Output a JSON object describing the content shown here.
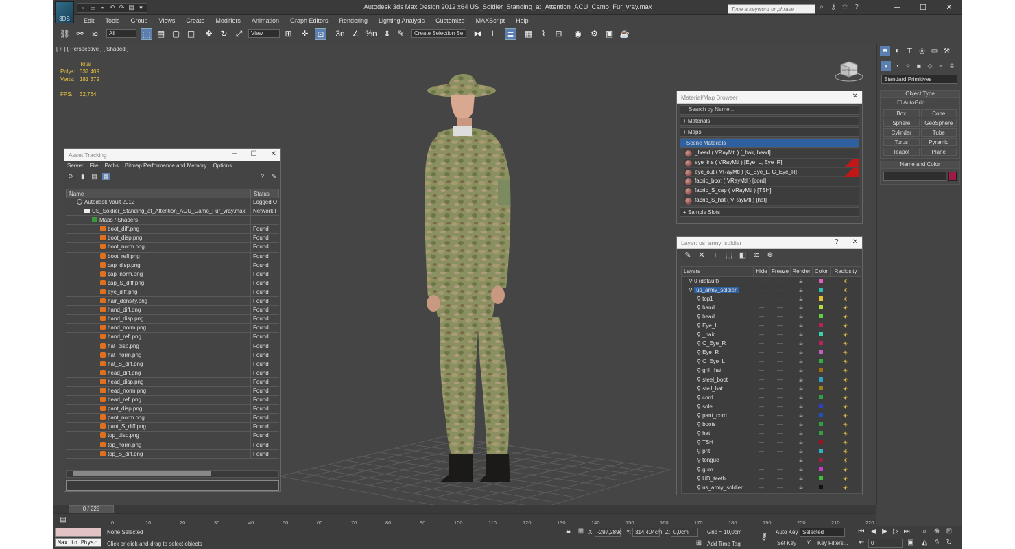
{
  "window": {
    "title": "Autodesk 3ds Max Design 2012 x64      US_Soldier_Standing_at_Attention_ACU_Camo_Fur_vray.max",
    "search_placeholder": "Type a keyword or phrase",
    "logo": "3DS"
  },
  "menu": [
    "Edit",
    "Tools",
    "Group",
    "Views",
    "Create",
    "Modifiers",
    "Animation",
    "Graph Editors",
    "Rendering",
    "Lighting Analysis",
    "Customize",
    "MAXScript",
    "Help"
  ],
  "toolbar": {
    "filter_value": "All",
    "ref_coord": "View",
    "selection_set_placeholder": "Create Selection Se",
    "snap_labels": [
      "3",
      "n",
      "%",
      "n"
    ]
  },
  "viewport": {
    "label": "[ + ] [ Perspective ] [ Shaded ]",
    "stats": {
      "header": "Total",
      "polys_label": "Polys:",
      "polys_value": "337 409",
      "verts_label": "Verts:",
      "verts_value": "181 379",
      "fps_label": "FPS:",
      "fps_value": "32,764"
    },
    "viewcube_label": "FRONT RIGHT"
  },
  "command_panel": {
    "dropdown": "Standard Primitives",
    "object_type_title": "Object Type",
    "autogrid": "AutoGrid",
    "buttons": [
      "Box",
      "Cone",
      "Sphere",
      "GeoSphere",
      "Cylinder",
      "Tube",
      "Torus",
      "Pyramid",
      "Teapot",
      "Plane"
    ],
    "name_color_title": "Name and Color",
    "swatch_color": "#a01848"
  },
  "asset_tracking": {
    "title": "Asset Tracking",
    "menu": [
      "Server",
      "File",
      "Paths",
      "Bitmap Performance and Memory",
      "Options"
    ],
    "col_name": "Name",
    "col_status": "Status",
    "vault": {
      "name": "Autodesk Vault 2012",
      "status": "Logged O"
    },
    "file": {
      "name": "US_Soldier_Standing_at_Attention_ACU_Camo_Fur_vray.max",
      "status": "Network F"
    },
    "maps_group": "Maps / Shaders",
    "maps": [
      {
        "name": "boot_diff.png",
        "status": "Found"
      },
      {
        "name": "boot_disp.png",
        "status": "Found"
      },
      {
        "name": "boot_norm.png",
        "status": "Found"
      },
      {
        "name": "boot_refl.png",
        "status": "Found"
      },
      {
        "name": "cap_disp.png",
        "status": "Found"
      },
      {
        "name": "cap_norm.png",
        "status": "Found"
      },
      {
        "name": "cap_S_diff.png",
        "status": "Found"
      },
      {
        "name": "eye_diff.png",
        "status": "Found"
      },
      {
        "name": "hair_density.png",
        "status": "Found"
      },
      {
        "name": "hand_diff.png",
        "status": "Found"
      },
      {
        "name": "hand_disp.png",
        "status": "Found"
      },
      {
        "name": "hand_norm.png",
        "status": "Found"
      },
      {
        "name": "hand_refl.png",
        "status": "Found"
      },
      {
        "name": "hat_disp.png",
        "status": "Found"
      },
      {
        "name": "hat_norm.png",
        "status": "Found"
      },
      {
        "name": "hat_S_diff.png",
        "status": "Found"
      },
      {
        "name": "head_diff.png",
        "status": "Found"
      },
      {
        "name": "head_disp.png",
        "status": "Found"
      },
      {
        "name": "head_norm.png",
        "status": "Found"
      },
      {
        "name": "head_refl.png",
        "status": "Found"
      },
      {
        "name": "pant_disp.png",
        "status": "Found"
      },
      {
        "name": "pant_norm.png",
        "status": "Found"
      },
      {
        "name": "pant_S_diff.png",
        "status": "Found"
      },
      {
        "name": "top_disp.png",
        "status": "Found"
      },
      {
        "name": "top_norm.png",
        "status": "Found"
      },
      {
        "name": "top_S_diff.png",
        "status": "Found"
      }
    ]
  },
  "material_browser": {
    "title": "Material/Map Browser",
    "search": "Search by Name ...",
    "sections": [
      "+ Materials",
      "+ Maps",
      "- Scene Materials",
      "+ Sample Slots"
    ],
    "scene_materials": [
      {
        "name": "_head  ( VRayMtl )  [_hair, head]",
        "flag": false
      },
      {
        "name": "eye_ins  ( VRayMtl )  [Eye_L, Eye_R]",
        "flag": true
      },
      {
        "name": "eye_out  ( VRayMtl )  [C_Eye_L, C_Eye_R]",
        "flag": true
      },
      {
        "name": "fabric_boot  ( VRayMtl )  [cord]",
        "flag": false
      },
      {
        "name": "fabric_S_cap  ( VRayMtl )  [TSH]",
        "flag": false
      },
      {
        "name": "fabric_S_hat  ( VRayMtl )  [hat]",
        "flag": false
      }
    ]
  },
  "layers": {
    "title": "Layer: us_army_soldier",
    "columns": [
      "Layers",
      "Hide",
      "Freeze",
      "Render",
      "Color",
      "Radiosity"
    ],
    "rows": [
      {
        "name": "0 (default)",
        "color": "#e060c0",
        "level": 0
      },
      {
        "name": "us_army_soldier",
        "color": "#30c0b0",
        "level": 0,
        "selected": true
      },
      {
        "name": "top1",
        "color": "#e0c030",
        "level": 1
      },
      {
        "name": "hand",
        "color": "#b0e040",
        "level": 1
      },
      {
        "name": "head",
        "color": "#60d040",
        "level": 1
      },
      {
        "name": "Eye_L",
        "color": "#c02050",
        "level": 1
      },
      {
        "name": "_hair",
        "color": "#40d0b0",
        "level": 1
      },
      {
        "name": "C_Eye_R",
        "color": "#c02060",
        "level": 1
      },
      {
        "name": "Eye_R",
        "color": "#c060c0",
        "level": 1
      },
      {
        "name": "C_Eye_L",
        "color": "#30b040",
        "level": 1
      },
      {
        "name": "grill_hat",
        "color": "#a07010",
        "level": 1
      },
      {
        "name": "steel_boot",
        "color": "#30a0c0",
        "level": 1
      },
      {
        "name": "stell_hat",
        "color": "#a08010",
        "level": 1
      },
      {
        "name": "cord",
        "color": "#30a040",
        "level": 1
      },
      {
        "name": "sole",
        "color": "#3040c0",
        "level": 1
      },
      {
        "name": "pant_cord",
        "color": "#2050c0",
        "level": 1
      },
      {
        "name": "boots",
        "color": "#30a040",
        "level": 1
      },
      {
        "name": "hat",
        "color": "#30a040",
        "level": 1
      },
      {
        "name": "TSH",
        "color": "#a01020",
        "level": 1
      },
      {
        "name": "prit",
        "color": "#30b0c0",
        "level": 1
      },
      {
        "name": "tongue",
        "color": "#a02040",
        "level": 1
      },
      {
        "name": "gum",
        "color": "#c040c0",
        "level": 1
      },
      {
        "name": "UD_teeth",
        "color": "#40c040",
        "level": 1
      },
      {
        "name": "us_army_soldier",
        "color": "#111111",
        "level": 1
      }
    ]
  },
  "timeline": {
    "slider": "0 / 225",
    "ticks": [
      "0",
      "10",
      "20",
      "30",
      "40",
      "50",
      "60",
      "70",
      "80",
      "90",
      "100",
      "110",
      "120",
      "130",
      "140",
      "150",
      "160",
      "170",
      "180",
      "190",
      "200",
      "210",
      "220"
    ]
  },
  "status": {
    "maxscript": "Max to Physc",
    "selection": "None Selected",
    "prompt": "Click or click-and-drag to select objects",
    "x_label": "X:",
    "x_value": "-297,289c",
    "y_label": "Y:",
    "y_value": "314,404cm",
    "z_label": "Z:",
    "z_value": "0,0cm",
    "grid": "Grid = 10,0cm",
    "add_time_tag": "Add Time Tag",
    "auto_key": "Auto Key",
    "set_key": "Set Key",
    "selected_option": "Selected",
    "key_filters": "Key Filters...",
    "frame": "0"
  }
}
